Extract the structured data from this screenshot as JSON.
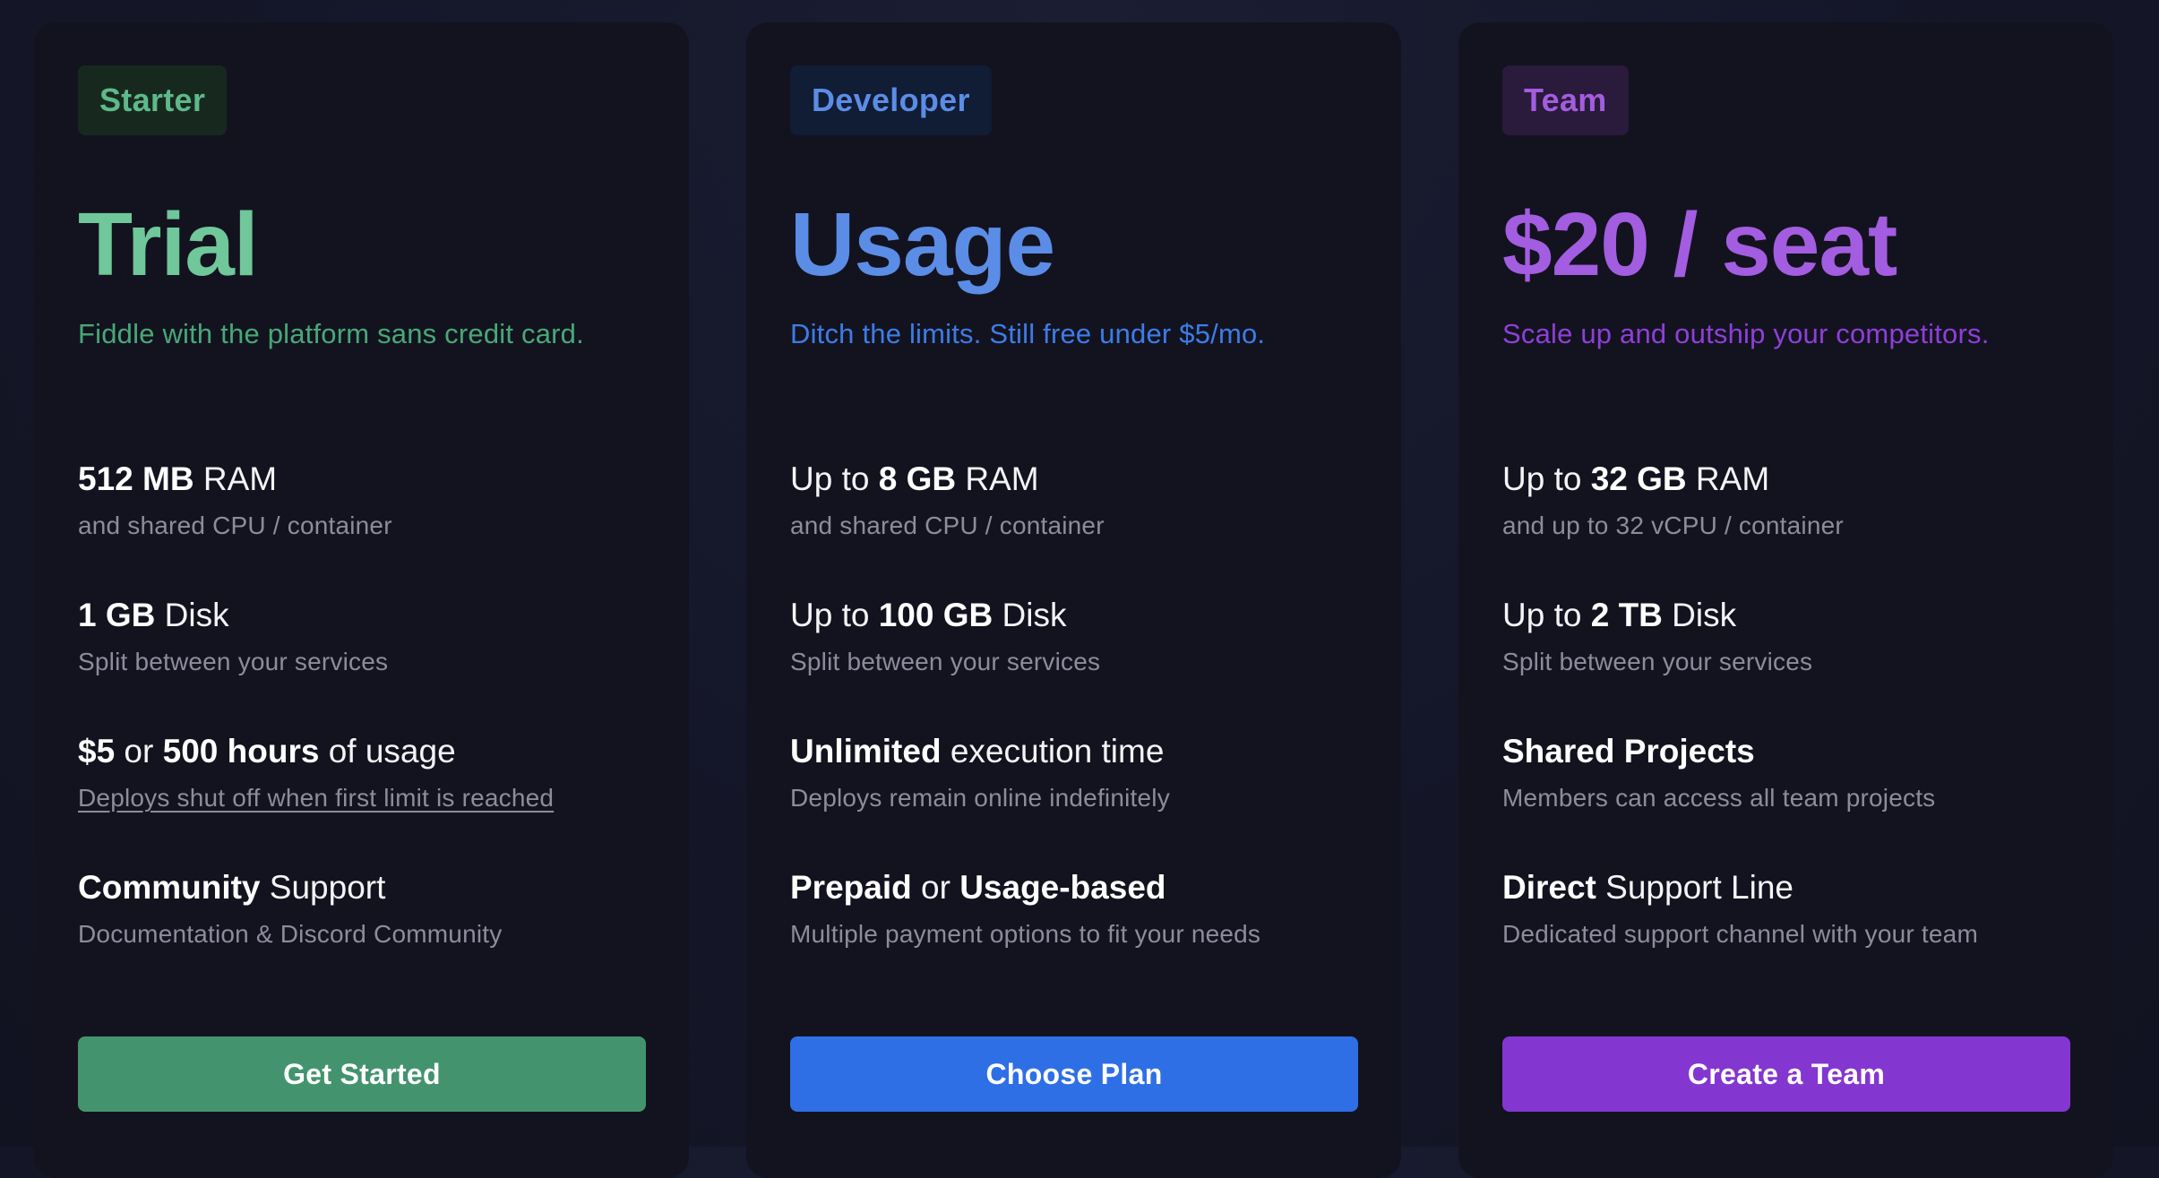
{
  "plans": [
    {
      "badge": "Starter",
      "price": "Trial",
      "tagline": "Fiddle with the platform sans credit card.",
      "colors": {
        "accent": "#6fc79a",
        "tagline": "#47a877",
        "badge_bg": "#17291f",
        "badge_text": "#5fb88a",
        "button": "#43946e"
      },
      "features": [
        {
          "pre": "",
          "b1": "512 MB",
          "mid": " RAM",
          "b2": "",
          "post": "",
          "sub": "and shared CPU / container"
        },
        {
          "pre": "",
          "b1": "1 GB",
          "mid": " Disk",
          "b2": "",
          "post": "",
          "sub": "Split between your services"
        },
        {
          "pre": "",
          "b1": "$5",
          "mid": " or ",
          "b2": "500 hours",
          "post": " of usage",
          "sub": "Deploys shut off when first limit is reached",
          "sub_underlined": true
        },
        {
          "pre": "",
          "b1": "Community",
          "mid": " Support",
          "b2": "",
          "post": "",
          "sub": "Documentation & Discord Community"
        }
      ],
      "button": "Get Started"
    },
    {
      "badge": "Developer",
      "price": "Usage",
      "tagline": "Ditch the limits. Still free under $5/mo.",
      "colors": {
        "accent": "#5b8de6",
        "tagline": "#3d7ce8",
        "badge_bg": "#111c35",
        "badge_text": "#5b8de6",
        "button": "#2f6fe6"
      },
      "features": [
        {
          "pre": "Up to ",
          "b1": "8 GB",
          "mid": " RAM",
          "b2": "",
          "post": "",
          "sub": "and shared CPU / container"
        },
        {
          "pre": "Up to ",
          "b1": "100 GB",
          "mid": " Disk",
          "b2": "",
          "post": "",
          "sub": "Split between your services"
        },
        {
          "pre": "",
          "b1": "Unlimited",
          "mid": " execution time",
          "b2": "",
          "post": "",
          "sub": "Deploys remain online indefinitely"
        },
        {
          "pre": "",
          "b1": "Prepaid",
          "mid": " or ",
          "b2": "Usage-based",
          "post": "",
          "sub": "Multiple payment options to fit your needs"
        }
      ],
      "button": "Choose Plan"
    },
    {
      "badge": "Team",
      "price": "$20 / seat",
      "tagline": "Scale up and outship your competitors.",
      "colors": {
        "accent": "#a35de0",
        "tagline": "#8e3fd9",
        "badge_bg": "#2a1a3b",
        "badge_text": "#a35de0",
        "button": "#8436d1"
      },
      "features": [
        {
          "pre": "Up to ",
          "b1": "32 GB",
          "mid": " RAM",
          "b2": "",
          "post": "",
          "sub": "and up to 32 vCPU / container"
        },
        {
          "pre": "Up to ",
          "b1": "2 TB",
          "mid": " Disk",
          "b2": "",
          "post": "",
          "sub": "Split between your services"
        },
        {
          "pre": "",
          "b1": "Shared Projects",
          "mid": "",
          "b2": "",
          "post": "",
          "sub": "Members can access all team projects"
        },
        {
          "pre": "",
          "b1": "Direct",
          "mid": " Support Line",
          "b2": "",
          "post": "",
          "sub": "Dedicated support channel with your team"
        }
      ],
      "button": "Create a Team"
    }
  ]
}
